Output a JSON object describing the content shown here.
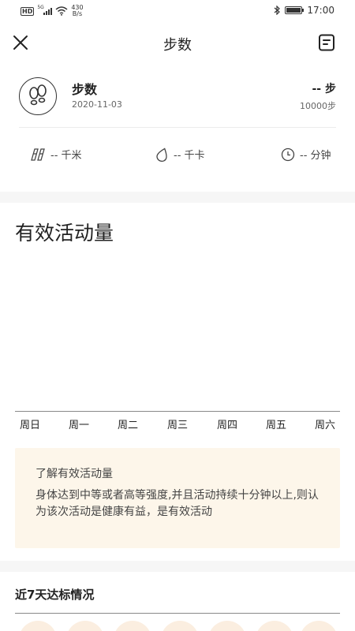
{
  "status_bar": {
    "network_badge": "HD",
    "signal_label": "5G",
    "speed_value": "430",
    "speed_unit": "B/s",
    "time": "17:00",
    "battery_level": 0.95
  },
  "header": {
    "title": "步数"
  },
  "summary": {
    "name": "步数",
    "date": "2020-11-03",
    "value": "-- 步",
    "goal": "10000步"
  },
  "metrics": [
    {
      "icon": "walking-distance-icon",
      "label": "-- 千米"
    },
    {
      "icon": "calorie-drop-icon",
      "label": "-- 千卡"
    },
    {
      "icon": "clock-icon",
      "label": "-- 分钟"
    }
  ],
  "activity": {
    "title": "有效活动量",
    "days": [
      "周日",
      "周一",
      "周二",
      "周三",
      "周四",
      "周五",
      "周六"
    ]
  },
  "info": {
    "title": "了解有效活动量",
    "body": "身体达到中等或者高等强度,并且活动持续十分钟以上,则认为该次活动是健康有益，是有效活动"
  },
  "week": {
    "title": "近7天达标情况"
  },
  "colors": {
    "info_bg": "#fdf6ea",
    "circle_bg": "#fbeee0",
    "separator": "#f6f6f6"
  }
}
